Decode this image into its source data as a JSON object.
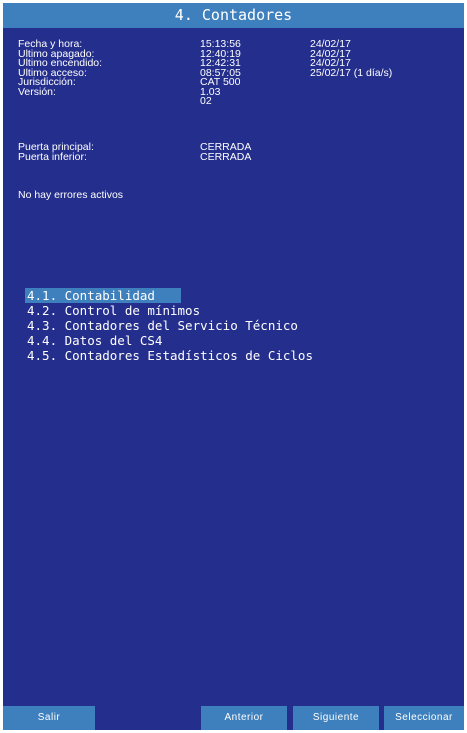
{
  "title": "4.  Contadores",
  "info_rows": [
    {
      "label": "Fecha y hora:",
      "value": "15:13:56",
      "extra": "24/02/17"
    },
    {
      "label": "Ultimo apagado:",
      "value": "12:40:19",
      "extra": "24/02/17"
    },
    {
      "label": "Ultimo encendido:",
      "value": "12:42:31",
      "extra": "24/02/17"
    },
    {
      "label": "Ultimo acceso:",
      "value": "08:57:05",
      "extra": "25/02/17 (1 día/s)"
    },
    {
      "label": "Jurisdicción:",
      "value": "CAT 500",
      "extra": ""
    },
    {
      "label": "Versión:",
      "value": "1.03",
      "extra": ""
    },
    {
      "label": "",
      "value": "02",
      "extra": ""
    }
  ],
  "doors": [
    {
      "label": "Puerta principal:",
      "value": "CERRADA"
    },
    {
      "label": "Puerta inferior:",
      "value": "CERRADA"
    }
  ],
  "errors_text": "No hay errores activos",
  "menu": [
    {
      "label": "4.1. Contabilidad"
    },
    {
      "label": "4.2. Control de mínimos"
    },
    {
      "label": "4.3. Contadores del Servicio Técnico"
    },
    {
      "label": "4.4. Datos del CS4"
    },
    {
      "label": "4.5. Contadores Estadísticos de Ciclos"
    }
  ],
  "footer": {
    "exit_label": "Salir",
    "prev_label": "Anterior",
    "next_label": "Siguiente",
    "select_label": "Seleccionar"
  },
  "colors": {
    "background": "#242e8c",
    "accent": "#3e7fbd",
    "text": "#ffffff"
  }
}
